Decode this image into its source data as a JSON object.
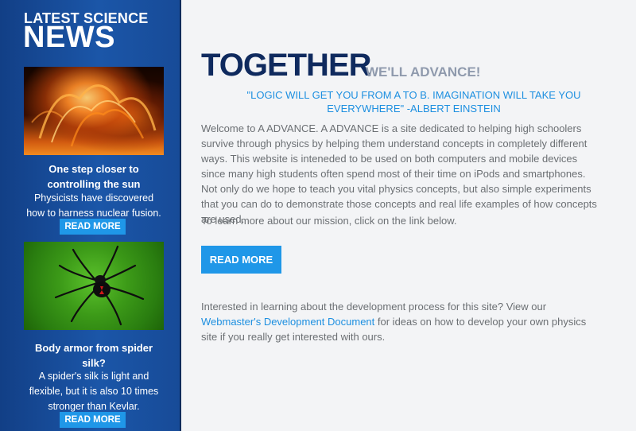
{
  "sidebar": {
    "heading_small": "LATEST SCIENCE",
    "heading_large": "NEWS",
    "articles": [
      {
        "title": "One step closer to controlling the sun",
        "summary": "Physicists have discovered how to harness nuclear fusion.",
        "button_label": "READ MORE",
        "image_subject": "solar-flare"
      },
      {
        "title": "Body armor from spider silk?",
        "summary": "A spider's silk is light and flexible, but it is also 10 times stronger than Kevlar.",
        "button_label": "READ MORE",
        "image_subject": "black-widow-spider"
      }
    ]
  },
  "main": {
    "heading": "TOGETHER",
    "subheading": "WE'LL ADVANCE!",
    "quote": "\"LOGIC WILL GET YOU FROM A TO B. IMAGINATION WILL TAKE YOU EVERYWHERE\" -ALBERT EINSTEIN",
    "intro": "Welcome to A ADVANCE. A ADVANCE is a site dedicated to helping high schoolers survive through physics by helping them understand concepts in completely different ways. This website is inteneded to be used on both computers and mobile devices since many high students often spend most of their time on iPods and smartphones. Not only do we hope to teach you vital physics concepts, but also simple experiments that you can do to demonstrate those concepts and real life examples of how concepts are used.",
    "mission": "To learn more about our mission, click on the link below.",
    "button_label": "READ MORE",
    "dev_text_before": "Interested in learning about the development process for this site? View our ",
    "dev_link": "Webmaster's Development Document",
    "dev_text_after": " for ideas on how to develop your own physics site if you really get interested with ours."
  },
  "colors": {
    "sidebar_blue": "#1b56a8",
    "button_blue": "#1f97e8",
    "heading_navy": "#0f2a5e",
    "quote_blue": "#1d8fe0",
    "body_gray": "#6b6f73"
  }
}
